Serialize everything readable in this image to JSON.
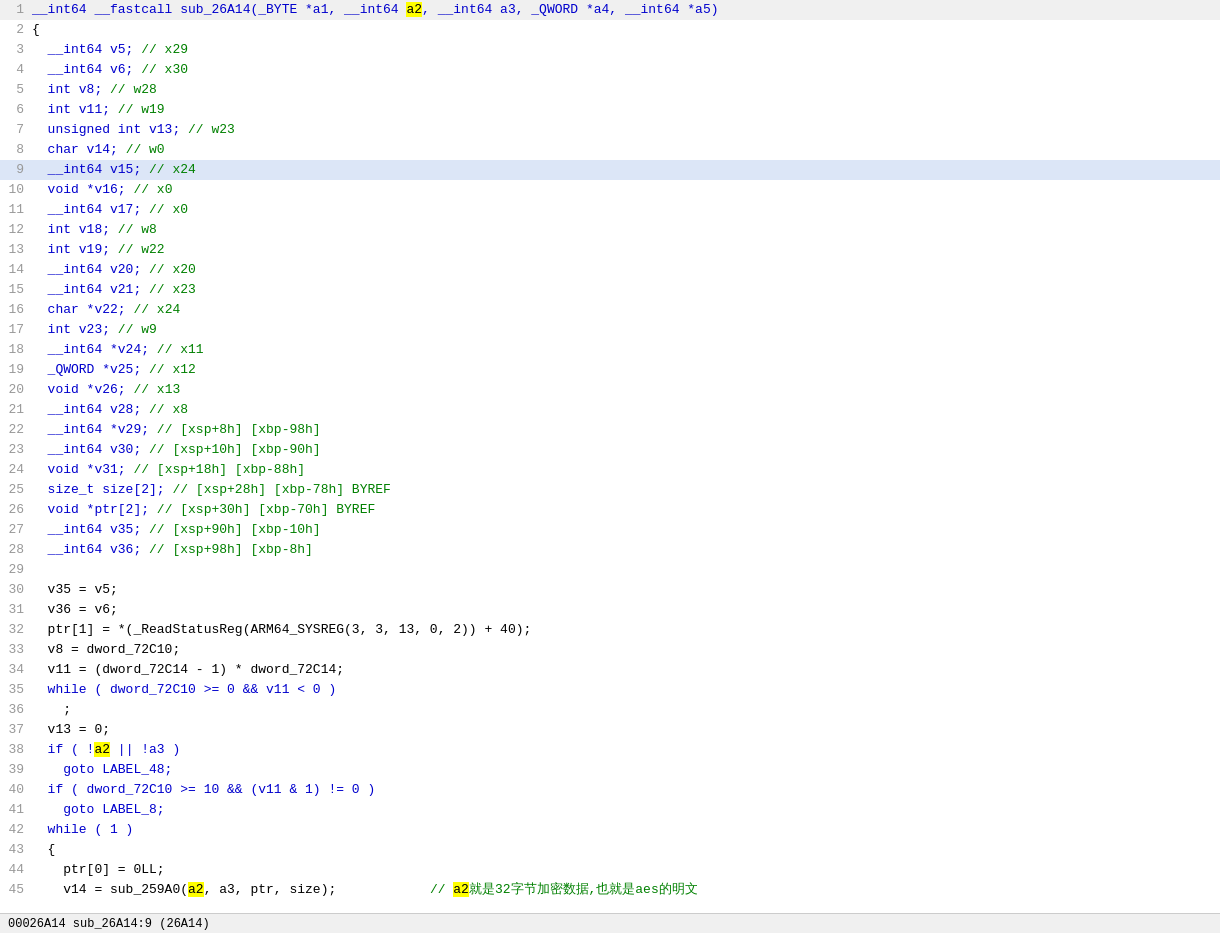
{
  "status_bar": {
    "text": "00026A14 sub_26A14:9 (26A14)"
  },
  "lines": [
    {
      "num": 1,
      "highlighted": false,
      "parts": [
        {
          "text": "__int64 __fastcall sub_26A14(_BYTE *a1, __int64 ",
          "cls": "c-type"
        },
        {
          "text": "a2",
          "cls": "c-highlight"
        },
        {
          "text": ", __int64 a3, _QWORD *a4, __int64 *a5)",
          "cls": "c-type"
        }
      ]
    },
    {
      "num": 2,
      "highlighted": false,
      "parts": [
        {
          "text": "{",
          "cls": "c-punct"
        }
      ]
    },
    {
      "num": 3,
      "highlighted": false,
      "parts": [
        {
          "text": "  __int64 v5; ",
          "cls": "c-type"
        },
        {
          "text": "// x29",
          "cls": "c-comment"
        }
      ]
    },
    {
      "num": 4,
      "highlighted": false,
      "parts": [
        {
          "text": "  __int64 v6; ",
          "cls": "c-type"
        },
        {
          "text": "// x30",
          "cls": "c-comment"
        }
      ]
    },
    {
      "num": 5,
      "highlighted": false,
      "parts": [
        {
          "text": "  int v8; ",
          "cls": "c-type"
        },
        {
          "text": "// w28",
          "cls": "c-comment"
        }
      ]
    },
    {
      "num": 6,
      "highlighted": false,
      "parts": [
        {
          "text": "  int v11; ",
          "cls": "c-type"
        },
        {
          "text": "// w19",
          "cls": "c-comment"
        }
      ]
    },
    {
      "num": 7,
      "highlighted": false,
      "parts": [
        {
          "text": "  unsigned int v13; ",
          "cls": "c-type"
        },
        {
          "text": "// w23",
          "cls": "c-comment"
        }
      ]
    },
    {
      "num": 8,
      "highlighted": false,
      "parts": [
        {
          "text": "  char v14; ",
          "cls": "c-type"
        },
        {
          "text": "// w0",
          "cls": "c-comment"
        }
      ]
    },
    {
      "num": 9,
      "highlighted": true,
      "parts": [
        {
          "text": "  __int64 v15; ",
          "cls": "c-type"
        },
        {
          "text": "// x24",
          "cls": "c-comment"
        }
      ]
    },
    {
      "num": 10,
      "highlighted": false,
      "parts": [
        {
          "text": "  void *v16; ",
          "cls": "c-type"
        },
        {
          "text": "// x0",
          "cls": "c-comment"
        }
      ]
    },
    {
      "num": 11,
      "highlighted": false,
      "parts": [
        {
          "text": "  __int64 v17; ",
          "cls": "c-type"
        },
        {
          "text": "// x0",
          "cls": "c-comment"
        }
      ]
    },
    {
      "num": 12,
      "highlighted": false,
      "parts": [
        {
          "text": "  int v18; ",
          "cls": "c-type"
        },
        {
          "text": "// w8",
          "cls": "c-comment"
        }
      ]
    },
    {
      "num": 13,
      "highlighted": false,
      "parts": [
        {
          "text": "  int v19; ",
          "cls": "c-type"
        },
        {
          "text": "// w22",
          "cls": "c-comment"
        }
      ]
    },
    {
      "num": 14,
      "highlighted": false,
      "parts": [
        {
          "text": "  __int64 v20; ",
          "cls": "c-type"
        },
        {
          "text": "// x20",
          "cls": "c-comment"
        }
      ]
    },
    {
      "num": 15,
      "highlighted": false,
      "parts": [
        {
          "text": "  __int64 v21; ",
          "cls": "c-type"
        },
        {
          "text": "// x23",
          "cls": "c-comment"
        }
      ]
    },
    {
      "num": 16,
      "highlighted": false,
      "parts": [
        {
          "text": "  char *v22; ",
          "cls": "c-type"
        },
        {
          "text": "// x24",
          "cls": "c-comment"
        }
      ]
    },
    {
      "num": 17,
      "highlighted": false,
      "parts": [
        {
          "text": "  int v23; ",
          "cls": "c-type"
        },
        {
          "text": "// w9",
          "cls": "c-comment"
        }
      ]
    },
    {
      "num": 18,
      "highlighted": false,
      "parts": [
        {
          "text": "  __int64 *v24; ",
          "cls": "c-type"
        },
        {
          "text": "// x11",
          "cls": "c-comment"
        }
      ]
    },
    {
      "num": 19,
      "highlighted": false,
      "parts": [
        {
          "text": "  _QWORD *v25; ",
          "cls": "c-type"
        },
        {
          "text": "// x12",
          "cls": "c-comment"
        }
      ]
    },
    {
      "num": 20,
      "highlighted": false,
      "parts": [
        {
          "text": "  void *v26; ",
          "cls": "c-type"
        },
        {
          "text": "// x13",
          "cls": "c-comment"
        }
      ]
    },
    {
      "num": 21,
      "highlighted": false,
      "parts": [
        {
          "text": "  __int64 v28; ",
          "cls": "c-type"
        },
        {
          "text": "// x8",
          "cls": "c-comment"
        }
      ]
    },
    {
      "num": 22,
      "highlighted": false,
      "parts": [
        {
          "text": "  __int64 *v29; ",
          "cls": "c-type"
        },
        {
          "text": "// [xsp+8h] [xbp-98h]",
          "cls": "c-comment"
        }
      ]
    },
    {
      "num": 23,
      "highlighted": false,
      "parts": [
        {
          "text": "  __int64 v30; ",
          "cls": "c-type"
        },
        {
          "text": "// [xsp+10h] [xbp-90h]",
          "cls": "c-comment"
        }
      ]
    },
    {
      "num": 24,
      "highlighted": false,
      "parts": [
        {
          "text": "  void *v31; ",
          "cls": "c-type"
        },
        {
          "text": "// [xsp+18h] [xbp-88h]",
          "cls": "c-comment"
        }
      ]
    },
    {
      "num": 25,
      "highlighted": false,
      "parts": [
        {
          "text": "  size_t size[2]; ",
          "cls": "c-type"
        },
        {
          "text": "// [xsp+28h] [xbp-78h] BYREF",
          "cls": "c-comment"
        }
      ]
    },
    {
      "num": 26,
      "highlighted": false,
      "parts": [
        {
          "text": "  void *ptr[2]; ",
          "cls": "c-type"
        },
        {
          "text": "// [xsp+30h] [xbp-70h] BYREF",
          "cls": "c-comment"
        }
      ]
    },
    {
      "num": 27,
      "highlighted": false,
      "parts": [
        {
          "text": "  __int64 v35; ",
          "cls": "c-type"
        },
        {
          "text": "// [xsp+90h] [xbp-10h]",
          "cls": "c-comment"
        }
      ]
    },
    {
      "num": 28,
      "highlighted": false,
      "parts": [
        {
          "text": "  __int64 v36; ",
          "cls": "c-type"
        },
        {
          "text": "// [xsp+98h] [xbp-8h]",
          "cls": "c-comment"
        }
      ]
    },
    {
      "num": 29,
      "highlighted": false,
      "parts": [
        {
          "text": "",
          "cls": ""
        }
      ]
    },
    {
      "num": 30,
      "highlighted": false,
      "parts": [
        {
          "text": "  v35 = v5;",
          "cls": "c-punct"
        }
      ]
    },
    {
      "num": 31,
      "highlighted": false,
      "parts": [
        {
          "text": "  v36 = v6;",
          "cls": "c-punct"
        }
      ]
    },
    {
      "num": 32,
      "highlighted": false,
      "parts": [
        {
          "text": "  ptr[1] = *(_ReadStatusReg(ARM64_SYSREG(3, 3, 13, 0, 2)) + 40);",
          "cls": "c-punct"
        }
      ]
    },
    {
      "num": 33,
      "highlighted": false,
      "parts": [
        {
          "text": "  v8 = dword_72C10;",
          "cls": "c-punct"
        }
      ]
    },
    {
      "num": 34,
      "highlighted": false,
      "parts": [
        {
          "text": "  v11 = (dword_72C14 - 1) * dword_72C14;",
          "cls": "c-punct"
        }
      ]
    },
    {
      "num": 35,
      "highlighted": false,
      "parts": [
        {
          "text": "  while ( dword_72C10 >= 0 && v11 < 0 )",
          "cls": "c-keyword"
        }
      ]
    },
    {
      "num": 36,
      "highlighted": false,
      "parts": [
        {
          "text": "    ;",
          "cls": "c-punct"
        }
      ]
    },
    {
      "num": 37,
      "highlighted": false,
      "parts": [
        {
          "text": "  v13 = 0;",
          "cls": "c-punct"
        }
      ]
    },
    {
      "num": 38,
      "highlighted": false,
      "parts": [
        {
          "text": "  if ( !",
          "cls": "c-keyword"
        },
        {
          "text": "a2",
          "cls": "c-highlight"
        },
        {
          "text": " || !a3 )",
          "cls": "c-keyword"
        }
      ]
    },
    {
      "num": 39,
      "highlighted": false,
      "parts": [
        {
          "text": "    goto LABEL_48;",
          "cls": "c-keyword"
        }
      ]
    },
    {
      "num": 40,
      "highlighted": false,
      "parts": [
        {
          "text": "  if ( dword_72C10 >= 10 && (v11 & 1) != 0 )",
          "cls": "c-keyword"
        }
      ]
    },
    {
      "num": 41,
      "highlighted": false,
      "parts": [
        {
          "text": "    goto LABEL_8;",
          "cls": "c-keyword"
        }
      ]
    },
    {
      "num": 42,
      "highlighted": false,
      "parts": [
        {
          "text": "  while ( 1 )",
          "cls": "c-keyword"
        }
      ]
    },
    {
      "num": 43,
      "highlighted": false,
      "parts": [
        {
          "text": "  {",
          "cls": "c-punct"
        }
      ]
    },
    {
      "num": 44,
      "highlighted": false,
      "parts": [
        {
          "text": "    ptr[0] = 0LL;",
          "cls": "c-punct"
        }
      ]
    },
    {
      "num": 45,
      "highlighted": false,
      "parts": [
        {
          "text": "    v14 = sub_259A0(",
          "cls": "c-punct"
        },
        {
          "text": "a2",
          "cls": "c-highlight"
        },
        {
          "text": ", a3, ptr, size);",
          "cls": "c-punct"
        },
        {
          "text": "            // ",
          "cls": "c-comment"
        },
        {
          "text": "a2",
          "cls": "c-highlight"
        },
        {
          "text": "就是32字节加密数据,也就是aes的明文",
          "cls": "c-comment"
        }
      ]
    }
  ]
}
